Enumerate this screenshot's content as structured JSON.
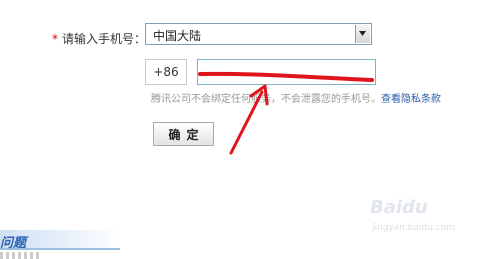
{
  "form": {
    "phone_label": "请输入手机号：",
    "required_mark": "*",
    "region_value": "中国大陆",
    "country_code": "+86",
    "phone_value": "",
    "hint_text": "腾讯公司不会绑定任何服务，不会泄露您的手机号。",
    "hint_link": "查看隐私条款",
    "confirm_label": "确定"
  },
  "section": {
    "faq_title": "问题"
  },
  "watermark": {
    "logo": "Baidu",
    "text": "jingyan.baidu.com"
  },
  "colors": {
    "annotation_red": "#e0141b",
    "required_red": "#e00000",
    "link_blue": "#2a5da8",
    "input_border": "#7fb3c7"
  },
  "icons": {
    "dropdown_arrow": "triangle-down"
  }
}
